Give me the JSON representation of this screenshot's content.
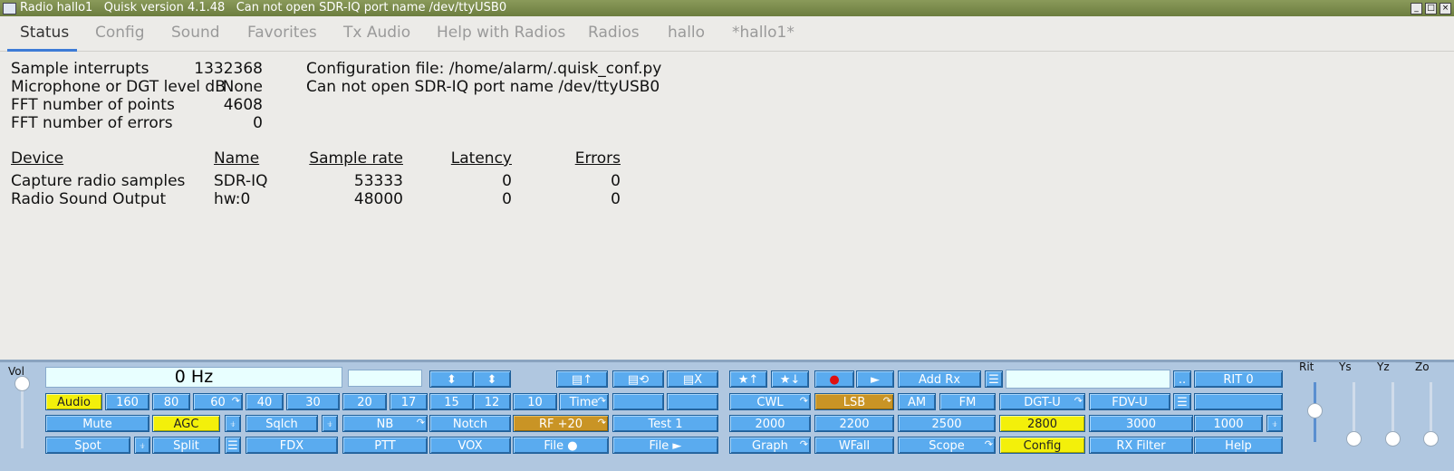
{
  "window": {
    "title": "Radio hallo1   Quisk version 4.1.48   Can not open SDR-IQ port name /dev/ttyUSB0"
  },
  "tabs": [
    "Status",
    "Config",
    "Sound",
    "Favorites",
    "Tx Audio",
    "Help with Radios",
    "Radios",
    "hallo",
    "*hallo1*"
  ],
  "status": {
    "sample_interrupts_label": "Sample interrupts",
    "sample_interrupts": "1332368",
    "mic_label": "Microphone or DGT level dB",
    "mic": "None",
    "fft_points_label": "FFT number of points",
    "fft_points": "4608",
    "fft_errors_label": "FFT number of errors",
    "fft_errors": "0",
    "config_file": "Configuration file:  /home/alarm/.quisk_conf.py",
    "error_msg": "Can not open SDR-IQ port name /dev/ttyUSB0",
    "headers": {
      "device": "Device",
      "name": "Name",
      "rate": "Sample rate",
      "latency": "Latency",
      "errors": "Errors"
    },
    "rows": [
      {
        "device": "Capture radio samples",
        "name": "SDR-IQ",
        "rate": "53333",
        "latency": "0",
        "errors": "0"
      },
      {
        "device": "Radio Sound Output",
        "name": "hw:0",
        "rate": "48000",
        "latency": "0",
        "errors": "0"
      }
    ]
  },
  "controls": {
    "vol_label": "Vol",
    "freq": "0 Hz",
    "addrx": "Add Rx",
    "dotdot": "..",
    "rit_btn": "RIT 0",
    "slider_labels": [
      "Rit",
      "Ys",
      "Yz",
      "Zo"
    ],
    "row1_left": [
      "Audio",
      "160",
      "80",
      "60",
      "40",
      "30",
      "20",
      "17",
      "15",
      "12",
      "10",
      "Time"
    ],
    "row1_right": [
      "CWL",
      "LSB",
      "AM",
      "FM",
      "DGT-U",
      "FDV-U"
    ],
    "row2_left": [
      "Mute",
      "AGC",
      "Sqlch",
      "NB",
      "Notch",
      "RF +20",
      "Test 1"
    ],
    "row2_right": [
      "2000",
      "2200",
      "2500",
      "2800",
      "3000",
      "1000"
    ],
    "row3_left": [
      "Spot",
      "Split",
      "FDX",
      "PTT",
      "VOX",
      "File ●",
      "File ►"
    ],
    "row3_right": [
      "Graph",
      "WFall",
      "Scope",
      "Config",
      "RX Filter",
      "Help"
    ],
    "star_up": "★↑",
    "star_down": "★↓",
    "rec": "●",
    "play": "►"
  }
}
